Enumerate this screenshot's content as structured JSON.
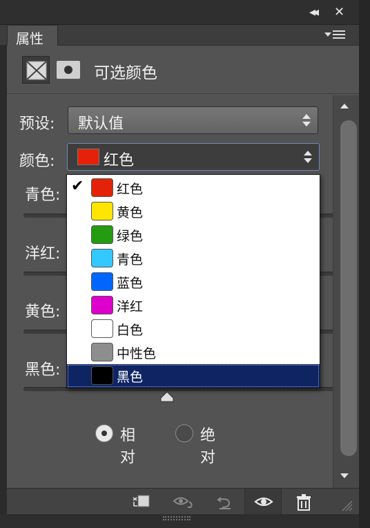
{
  "window": {
    "collapse_glyph": "◂◂",
    "close_glyph": "✕"
  },
  "tab": {
    "label": "属性"
  },
  "header": {
    "title": "可选颜色"
  },
  "preset": {
    "label": "预设:",
    "value": "默认值"
  },
  "colors": {
    "label": "颜色:",
    "value": "红色",
    "value_swatch": "#e4220a",
    "options": [
      {
        "name": "红色",
        "swatch": "#e4220a",
        "checked": true,
        "selected": false
      },
      {
        "name": "黄色",
        "swatch": "#ffe600",
        "checked": false,
        "selected": false
      },
      {
        "name": "绿色",
        "swatch": "#249b10",
        "checked": false,
        "selected": false
      },
      {
        "name": "青色",
        "swatch": "#33c8ff",
        "checked": false,
        "selected": false
      },
      {
        "name": "蓝色",
        "swatch": "#0066ff",
        "checked": false,
        "selected": false
      },
      {
        "name": "洋红",
        "swatch": "#dd00cc",
        "checked": false,
        "selected": false
      },
      {
        "name": "白色",
        "swatch": "#ffffff",
        "checked": false,
        "selected": false
      },
      {
        "name": "中性色",
        "swatch": "#8e8e8e",
        "checked": false,
        "selected": false
      },
      {
        "name": "黑色",
        "swatch": "#000000",
        "checked": false,
        "selected": true
      }
    ]
  },
  "sliders": [
    {
      "label": "青色:"
    },
    {
      "label": "洋红:"
    },
    {
      "label": "黄色:"
    },
    {
      "label": "黑色:"
    }
  ],
  "method": {
    "relative_label": "相对",
    "absolute_label": "绝对",
    "selected": "relative"
  },
  "checkmark": "✔"
}
